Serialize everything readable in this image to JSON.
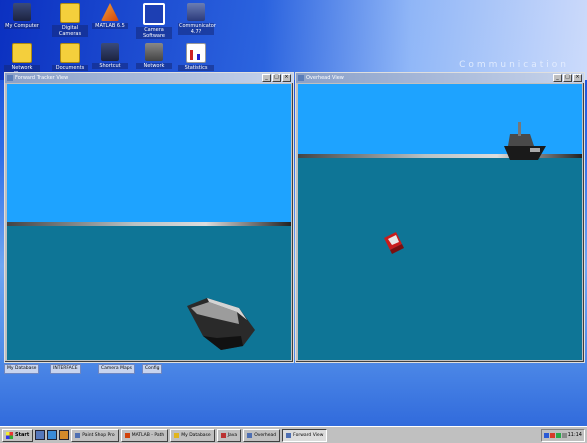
{
  "wallpaper": {
    "text": "Communication"
  },
  "desktop_icons": [
    {
      "label": "My Computer",
      "icon": "computer-icon"
    },
    {
      "label": "Digital Cameras",
      "icon": "folder-icon"
    },
    {
      "label": "MATLAB 6.5",
      "icon": "matlab-icon"
    },
    {
      "label": "Camera Software",
      "icon": "camera-icon"
    },
    {
      "label": "Communicator 4.7?",
      "icon": "communicator-icon"
    },
    {
      "label": "Network Places",
      "icon": "folder-icon"
    },
    {
      "label": "Documents",
      "icon": "folder-icon"
    },
    {
      "label": "Shortcut",
      "icon": "monitor-icon"
    },
    {
      "label": "Network",
      "icon": "network-icon"
    },
    {
      "label": "Statistics",
      "icon": "chart-icon"
    }
  ],
  "left_window": {
    "title": "Forward Tracker View",
    "buttons": {
      "minimize": "_",
      "maximize": "□",
      "close": "×"
    }
  },
  "right_window": {
    "title": "Overhead View",
    "buttons": {
      "minimize": "_",
      "maximize": "□",
      "close": "×"
    }
  },
  "minimized_items": [
    "My Database",
    "INTERFACE",
    "Camera Maps",
    "Config"
  ],
  "taskbar": {
    "start_label": "Start",
    "tasks": [
      {
        "label": "Paint Shop Pro"
      },
      {
        "label": "MATLAB - Path"
      },
      {
        "label": "My Database"
      },
      {
        "label": "Java"
      },
      {
        "label": "Overhead"
      },
      {
        "label": "Forward View"
      }
    ],
    "clock": "11:14"
  },
  "colors": {
    "sky": "#1ea3ff",
    "sea": "#0e7596",
    "titlebar": "#8aa0c8"
  }
}
